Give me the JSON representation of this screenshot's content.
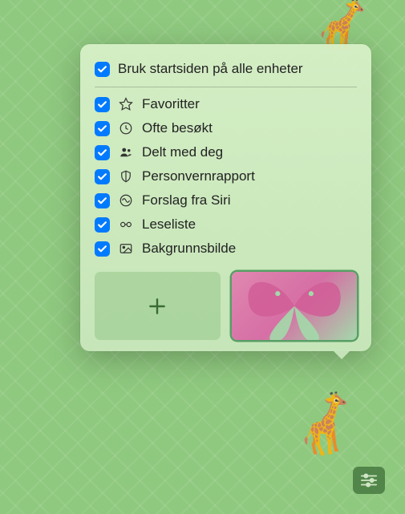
{
  "header": {
    "label": "Bruk startsiden på alle enheter"
  },
  "options": [
    {
      "label": "Favoritter",
      "icon": "star-icon"
    },
    {
      "label": "Ofte besøkt",
      "icon": "clock-icon"
    },
    {
      "label": "Delt med deg",
      "icon": "people-icon"
    },
    {
      "label": "Personvernrapport",
      "icon": "shield-icon"
    },
    {
      "label": "Forslag fra Siri",
      "icon": "siri-icon"
    },
    {
      "label": "Leseliste",
      "icon": "glasses-icon"
    },
    {
      "label": "Bakgrunnsbilde",
      "icon": "image-icon"
    }
  ],
  "colors": {
    "accent": "#007aff",
    "background": "#8fc97f"
  }
}
